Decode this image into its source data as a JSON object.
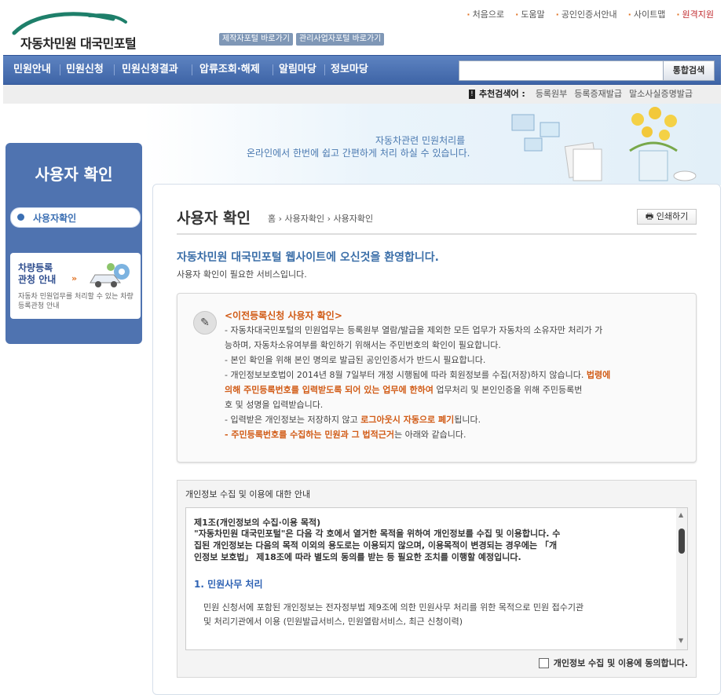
{
  "header": {
    "logo_text": "자동차민원 대국민포털",
    "quick_buttons": [
      "제작자포털 바로가기",
      "관리사업자포털 바로가기"
    ],
    "top_links": [
      "처음으로",
      "도움말",
      "공인인증서안내",
      "사이트맵"
    ],
    "remote_support": "원격지원"
  },
  "nav": {
    "items": [
      "민원안내",
      "민원신청",
      "민원신청결과",
      "압류조회·해제",
      "알림마당",
      "정보마당"
    ],
    "search_placeholder": "",
    "search_button": "통합검색"
  },
  "recommend": {
    "label": "추천검색어 :",
    "words": [
      "등록원부",
      "등록증재발급",
      "말소사실증명발급"
    ]
  },
  "banner": {
    "line1": "자동차관련 민원처리를",
    "line2": "온라인에서 한번에 쉽고 간편하게 처리 하실 수 있습니다."
  },
  "sidebar": {
    "title": "사용자 확인",
    "active_item": "사용자확인",
    "promo_title": "차량등록\n관청 안내",
    "promo_desc": "자동차 민원업무를 처리할 수 있는 차량등록관청 안내"
  },
  "main": {
    "title": "사용자 확인",
    "breadcrumb": [
      "홈",
      "사용자확인",
      "사용자확인"
    ],
    "print_label": "인쇄하기",
    "welcome": "자동차민원 대국민포털 웹사이트에 오신것을 환영합니다.",
    "welcome_sub": "사용자 확인이 필요한 서비스입니다.",
    "notice": {
      "title": "<이전등록신청 사용자 확인>",
      "line1": "- 자동차대국민포털의 민원업무는 등록원부 열람/발급을 제외한 모든 업무가 자동차의 소유자만 처리가 가",
      "line2": "능하며, 자동차소유여부를 확인하기 위해서는 주민번호의 확인이 필요합니다.",
      "line3": "- 본인 확인을 위해 본인 명의로 발급된 공인인증서가 반드시 필요합니다.",
      "line4a": "- 개인정보보호법이 2014년 8월 7일부터 개정 시행됨에 따라 회원정보를 수집(저장)하지 않습니다. ",
      "line4b": "법령에",
      "line5a": "의해 주민등록번호를 입력받도록 되어 있는 업무에 한하여",
      "line5b": " 업무처리 및 본인인증을 위해 주민등록번",
      "line6": "호 및 성명을 입력받습니다.",
      "line7a": "- 입력받은 개인정보는 저장하지 않고 ",
      "line7b": "로그아웃시 자동으로 폐기",
      "line7c": "됩니다.",
      "line8a": "- 주민등록번호를 수집하는 민원과 그 법적근거",
      "line8b": "는 아래와 같습니다."
    },
    "privacy": {
      "header": "개인정보 수집 및 이용에 대한 안내",
      "article_title": "제1조(개인정보의 수집·이용 목적)",
      "article_line1": "\"자동차민원 대국민포털\"은 다음 각 호에서 열거한 목적을 위하여 개인정보를 수집 및 이용합니다. 수",
      "article_line2": "집된 개인정보는 다음의 목적 이외의 용도로는 이용되지 않으며, 이용목적이 변경되는 경우에는 「개",
      "article_line3": "인정보 보호법」 제18조에 따라 별도의 동의를 받는 등 필요한 조치를 이행할 예정입니다.",
      "section_title": "1. 민원사무 처리",
      "section_line1": "민원 신청서에 포함된 개인정보는 전자정부법 제9조에 의한 민원사무 처리를 위한 목적으로 민원 접수기관",
      "section_line2": "및 처리기관에서 이용 (민원발급서비스, 민원열람서비스, 최근 신청이력)",
      "agree_label": "개인정보 수집 및 이용에 동의합니다."
    }
  }
}
